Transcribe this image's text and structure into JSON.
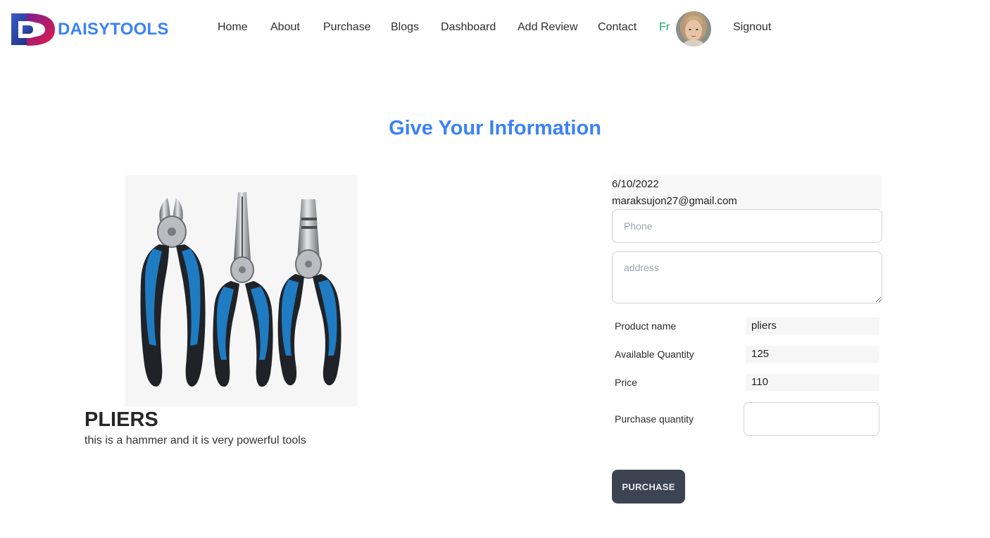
{
  "brand": {
    "name": "DAISYTOOLS",
    "logo_letter": "D"
  },
  "nav": {
    "links": [
      "Home",
      "About",
      "Purchase",
      "Blogs",
      "Dashboard",
      "Add Review",
      "Contact"
    ],
    "user_name": "Fr",
    "signout_label": "Signout"
  },
  "page": {
    "title": "Give Your Information"
  },
  "product": {
    "image_icon": "pliers-image",
    "name": "PLIERS",
    "description": "this is a hammer and it is very powerful tools"
  },
  "form": {
    "date": "6/10/2022",
    "email": "maraksujon27@gmail.com",
    "phone_placeholder": "Phone",
    "address_placeholder": "address",
    "fields": [
      {
        "label": "Product name",
        "value": "pliers"
      },
      {
        "label": "Available Quantity",
        "value": "125"
      },
      {
        "label": "Price",
        "value": "110"
      }
    ],
    "purchase_quantity_label": "Purchase quantity",
    "purchase_quantity_value": "",
    "submit_label": "PURCHASE"
  },
  "colors": {
    "accent": "#3b82f6",
    "user_name": "#22a55a",
    "button_bg": "#3d4451",
    "logo_navy": "#1e3a8a",
    "logo_red": "#dc2626"
  }
}
